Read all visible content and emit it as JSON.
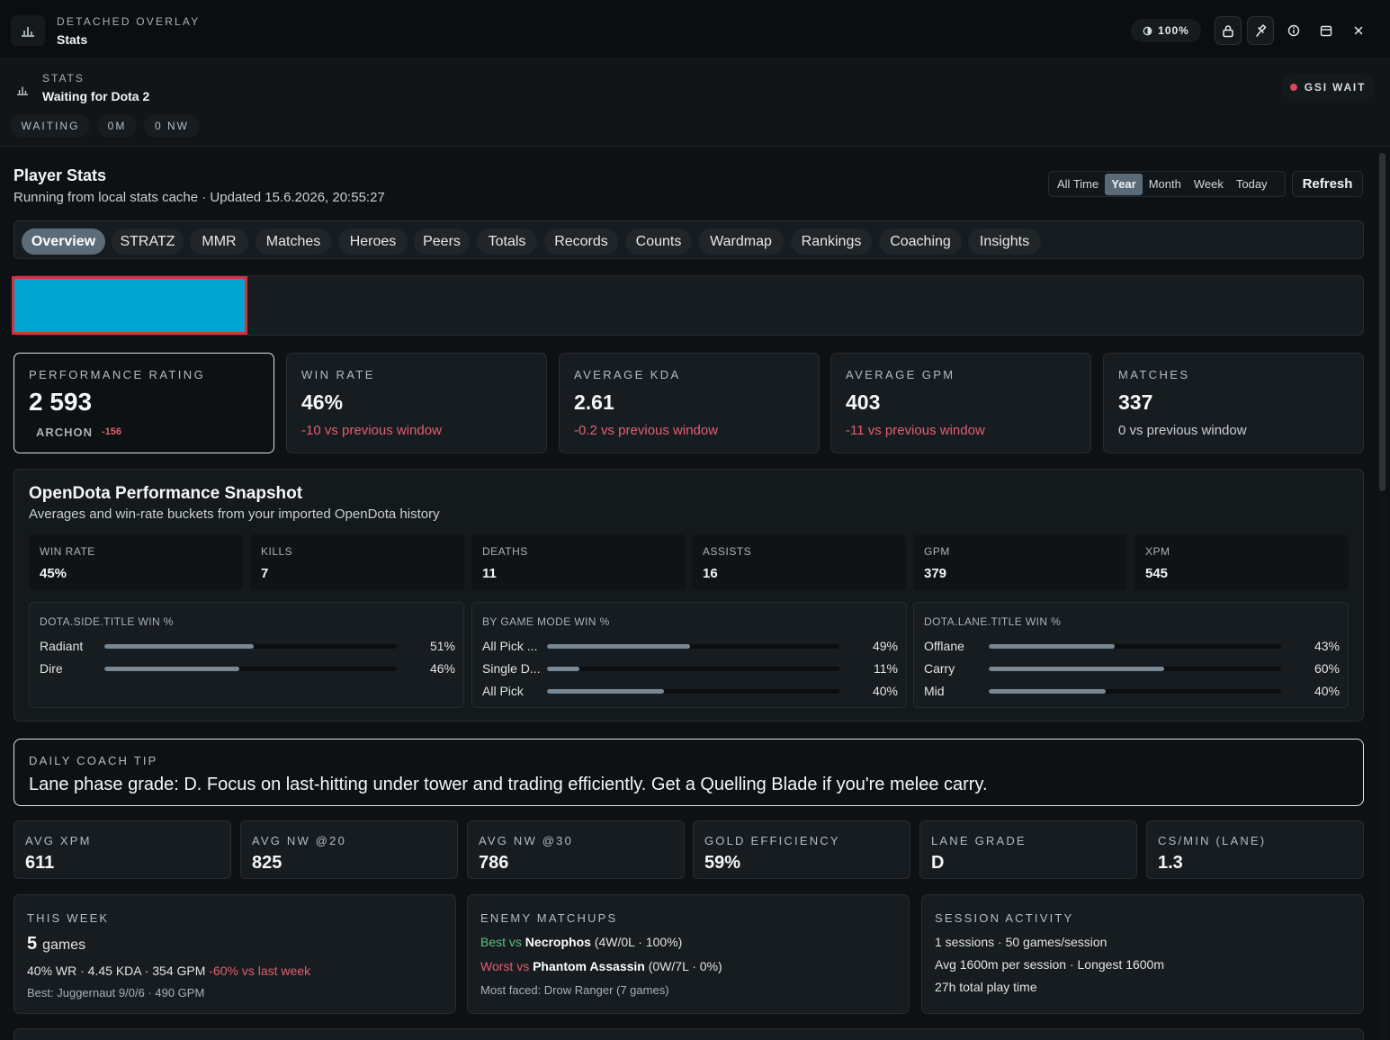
{
  "titlebar": {
    "eyebrow": "DETACHED OVERLAY",
    "title": "Stats",
    "zoom": "100%",
    "icons": [
      "bar-chart-icon",
      "brightness-icon",
      "lock-icon",
      "pin-icon",
      "info-icon",
      "window-icon",
      "close-icon"
    ]
  },
  "statsbar": {
    "eyebrow": "STATS",
    "title": "Waiting for Dota 2",
    "chips": [
      "WAITING",
      "0M",
      "0 NW"
    ],
    "gsi_status": "GSI WAIT",
    "gsi_color": "#e0455a"
  },
  "header": {
    "title": "Player Stats",
    "subtitle": "Running from local stats cache · Updated 15.6.2026, 20:55:27",
    "ranges": [
      "All Time",
      "Year",
      "Month",
      "Week",
      "Today"
    ],
    "active_range": "Year",
    "refresh_label": "Refresh"
  },
  "tabs": [
    "Overview",
    "STRATZ",
    "MMR",
    "Matches",
    "Heroes",
    "Peers",
    "Totals",
    "Records",
    "Counts",
    "Wardmap",
    "Rankings",
    "Coaching",
    "Insights"
  ],
  "active_tab": "Overview",
  "kpis": [
    {
      "label": "PERFORMANCE RATING",
      "value": "2 593",
      "rank": "ARCHON",
      "rank_delta": "-156"
    },
    {
      "label": "WIN RATE",
      "value": "46%",
      "delta": "-10 vs previous window",
      "tone": "neg"
    },
    {
      "label": "AVERAGE KDA",
      "value": "2.61",
      "delta": "-0.2 vs previous window",
      "tone": "neg"
    },
    {
      "label": "AVERAGE GPM",
      "value": "403",
      "delta": "-11 vs previous window",
      "tone": "neg"
    },
    {
      "label": "MATCHES",
      "value": "337",
      "delta": "0 vs previous window",
      "tone": "neu"
    }
  ],
  "snapshot": {
    "title": "OpenDota Performance Snapshot",
    "subtitle": "Averages and win-rate buckets from your imported OpenDota history",
    "minis": [
      {
        "label": "WIN RATE",
        "value": "45%"
      },
      {
        "label": "KILLS",
        "value": "7"
      },
      {
        "label": "DEATHS",
        "value": "11"
      },
      {
        "label": "ASSISTS",
        "value": "16"
      },
      {
        "label": "GPM",
        "value": "379"
      },
      {
        "label": "XPM",
        "value": "545"
      }
    ],
    "buckets": [
      {
        "label": "DOTA.SIDE.TITLE WIN %",
        "rows": [
          {
            "name": "Radiant",
            "pct": 51,
            "pct_label": "51%"
          },
          {
            "name": "Dire",
            "pct": 46,
            "pct_label": "46%"
          }
        ]
      },
      {
        "label": "BY GAME MODE WIN %",
        "rows": [
          {
            "name": "All Pick ...",
            "pct": 49,
            "pct_label": "49%"
          },
          {
            "name": "Single D...",
            "pct": 11,
            "pct_label": "11%"
          },
          {
            "name": "All Pick",
            "pct": 40,
            "pct_label": "40%"
          }
        ]
      },
      {
        "label": "DOTA.LANE.TITLE WIN %",
        "rows": [
          {
            "name": "Offlane",
            "pct": 43,
            "pct_label": "43%"
          },
          {
            "name": "Carry",
            "pct": 60,
            "pct_label": "60%"
          },
          {
            "name": "Mid",
            "pct": 40,
            "pct_label": "40%"
          }
        ]
      }
    ]
  },
  "tip": {
    "label": "DAILY COACH TIP",
    "text": "Lane phase grade: D. Focus on last-hitting under tower and trading efficiently. Get a Quelling Blade if you're melee carry."
  },
  "stats": [
    {
      "label": "AVG XPM",
      "value": "611"
    },
    {
      "label": "AVG NW @20",
      "value": "825"
    },
    {
      "label": "AVG NW @30",
      "value": "786"
    },
    {
      "label": "GOLD EFFICIENCY",
      "value": "59%"
    },
    {
      "label": "LANE GRADE",
      "value": "D"
    },
    {
      "label": "CS/MIN (LANE)",
      "value": "1.3"
    }
  ],
  "week": {
    "label": "THIS WEEK",
    "count": "5",
    "unit": "games",
    "summary": "40% WR · 4.45 KDA · 354 GPM",
    "change": "-60% vs last week",
    "best": "Best: Juggernaut 9/0/6 · 490 GPM"
  },
  "matchups": {
    "label": "ENEMY MATCHUPS",
    "best_prefix": "Best vs",
    "best_hero": "Necrophos",
    "best_detail": "(4W/0L · 100%)",
    "worst_prefix": "Worst vs",
    "worst_hero": "Phantom Assassin",
    "worst_detail": "(0W/7L · 0%)",
    "most_faced": "Most faced: Drow Ranger (7 games)"
  },
  "session": {
    "label": "SESSION ACTIVITY",
    "line1": "1 sessions · 50 games/session",
    "line2": "Avg 1600m per session · Longest 1600m",
    "line3": "27h total play time"
  }
}
